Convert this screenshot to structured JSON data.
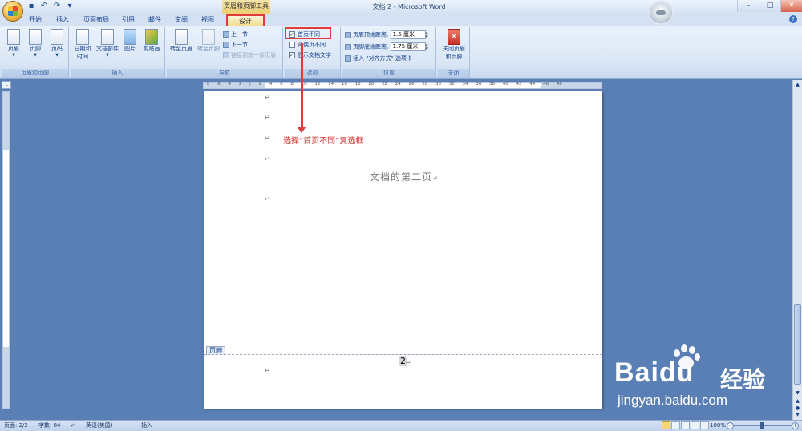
{
  "window": {
    "title": "文档 2 - Microsoft Word",
    "contextual_title": "页眉和页脚工具",
    "controls": [
      "–",
      "□",
      "✕"
    ]
  },
  "qat": [
    "save-icon",
    "undo-icon",
    "redo-icon",
    "customize-icon"
  ],
  "tabs": [
    "开始",
    "插入",
    "页面布局",
    "引用",
    "邮件",
    "审阅",
    "视图",
    "设计"
  ],
  "ribbon": {
    "header_footer_group": {
      "label": "页眉和页脚",
      "buttons": [
        "页眉",
        "页脚",
        "页码"
      ]
    },
    "insert_group": {
      "label": "插入",
      "buttons": [
        "日期和\n时间",
        "文档部件",
        "图片",
        "剪贴画"
      ],
      "date_time_line1": "日期和",
      "date_time_line2": "时间"
    },
    "nav_group": {
      "label": "导航",
      "goto_header": "转至页眉",
      "goto_footer": "转至页脚",
      "prev_section": "上一节",
      "next_section": "下一节",
      "link_previous": "链接到前一条页眉"
    },
    "options_group": {
      "label": "选项",
      "different_first_page": "首页不同",
      "different_first_page_checked": true,
      "different_odd_even": "奇偶页不同",
      "different_odd_even_checked": false,
      "show_doc_text": "显示文档文字",
      "show_doc_text_checked": true
    },
    "position_group": {
      "label": "位置",
      "header_top_label": "页眉顶端距离:",
      "header_top_value": "1.5 厘米",
      "footer_bottom_label": "页脚底端距离:",
      "footer_bottom_value": "1.75 厘米",
      "insert_align_tab": "插入 \"对齐方式\" 选项卡"
    },
    "close_group": {
      "label": "关闭",
      "close_button_line1": "关闭页眉",
      "close_button_line2": "和页脚"
    }
  },
  "ruler": {
    "h_ticks": "8 6 4 2 | 2 4 6 8 10 12 14 16 18 20 22 24 26 28 30 32 34 36 38 40 42 44 46 48"
  },
  "document": {
    "body_text": "文档的第二页",
    "paragraph_mark": "↵",
    "footer_tab": "页脚",
    "page_number": "2",
    "callout": "选择“首页不同”复选框"
  },
  "watermark": {
    "brand": "Baidu",
    "suffix": "经验",
    "url": "jingyan.baidu.com"
  },
  "status": {
    "page": "页面: 2/2",
    "words": "字数: 84",
    "language": "英语(美国)",
    "mode": "插入",
    "zoom": "100%"
  }
}
